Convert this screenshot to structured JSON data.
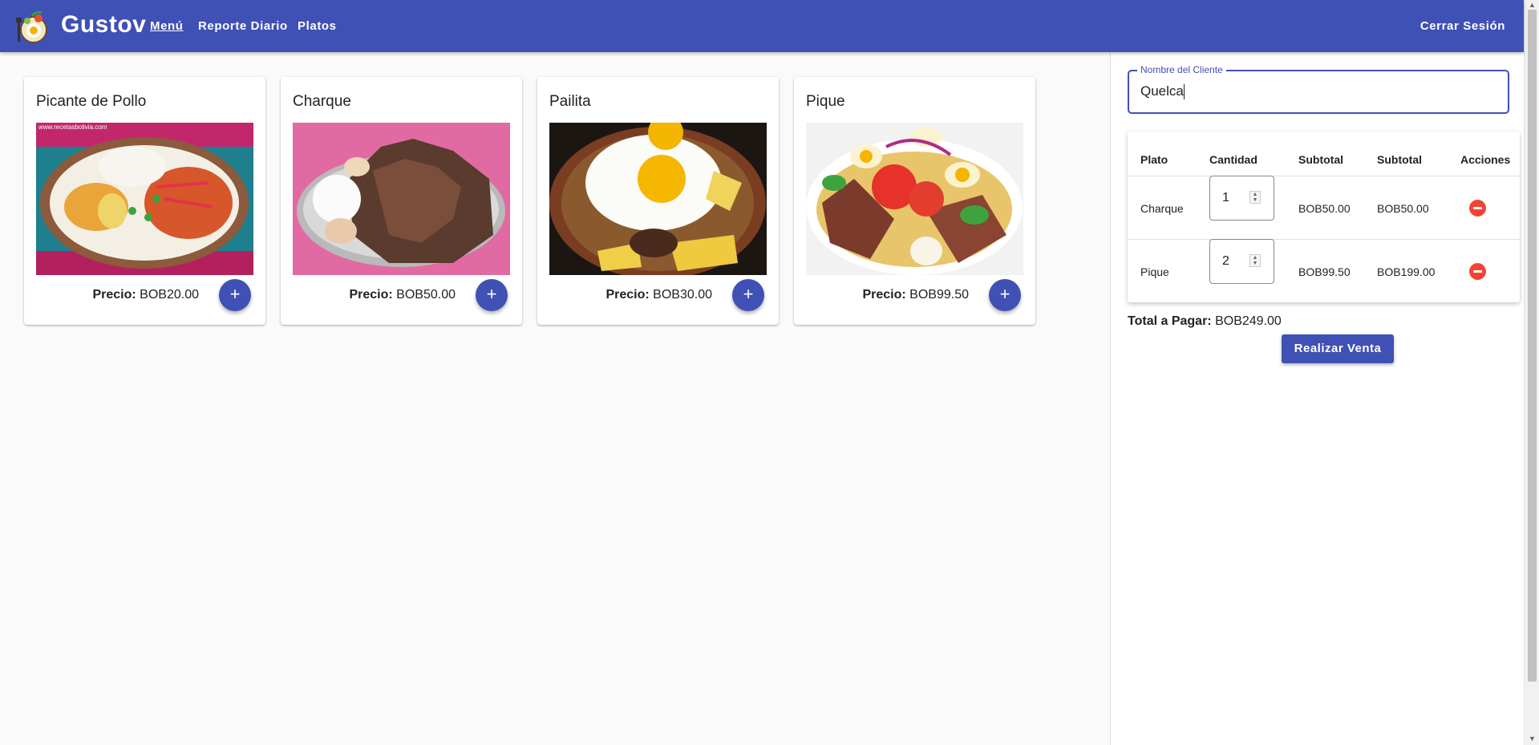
{
  "app": {
    "brand": "Gustov",
    "nav": [
      "Menú",
      "Reporte Diario",
      "Platos"
    ],
    "logout": "Cerrar Sesión"
  },
  "menu": [
    {
      "name": "Picante de Pollo",
      "price_label": "Precio:",
      "price": "BOB20.00",
      "image": "picante-de-pollo-photo"
    },
    {
      "name": "Charque",
      "price_label": "Precio:",
      "price": "BOB50.00",
      "image": "charque-photo"
    },
    {
      "name": "Pailita",
      "price_label": "Precio:",
      "price": "BOB30.00",
      "image": "pailita-photo"
    },
    {
      "name": "Pique",
      "price_label": "Precio:",
      "price": "BOB99.50",
      "image": "pique-photo"
    }
  ],
  "order": {
    "client_label": "Nombre del Cliente",
    "client_value": "Quelca",
    "headers": [
      "Plato",
      "Cantidad",
      "Subtotal",
      "Subtotal",
      "Acciones"
    ],
    "rows": [
      {
        "plato": "Charque",
        "cantidad": "1",
        "precio": "BOB50.00",
        "subtotal": "BOB50.00"
      },
      {
        "plato": "Pique",
        "cantidad": "2",
        "precio": "BOB99.50",
        "subtotal": "BOB199.00"
      }
    ],
    "total_label": "Total a Pagar:",
    "total_value": "BOB249.00",
    "submit_label": "Realizar Venta"
  },
  "colors": {
    "primary": "#3f51b5",
    "danger": "#f44336",
    "background": "#fafafa"
  },
  "icons": [
    "app-logo-icon",
    "plus-icon",
    "minus-circle-icon",
    "spin-up-icon",
    "spin-down-icon"
  ]
}
